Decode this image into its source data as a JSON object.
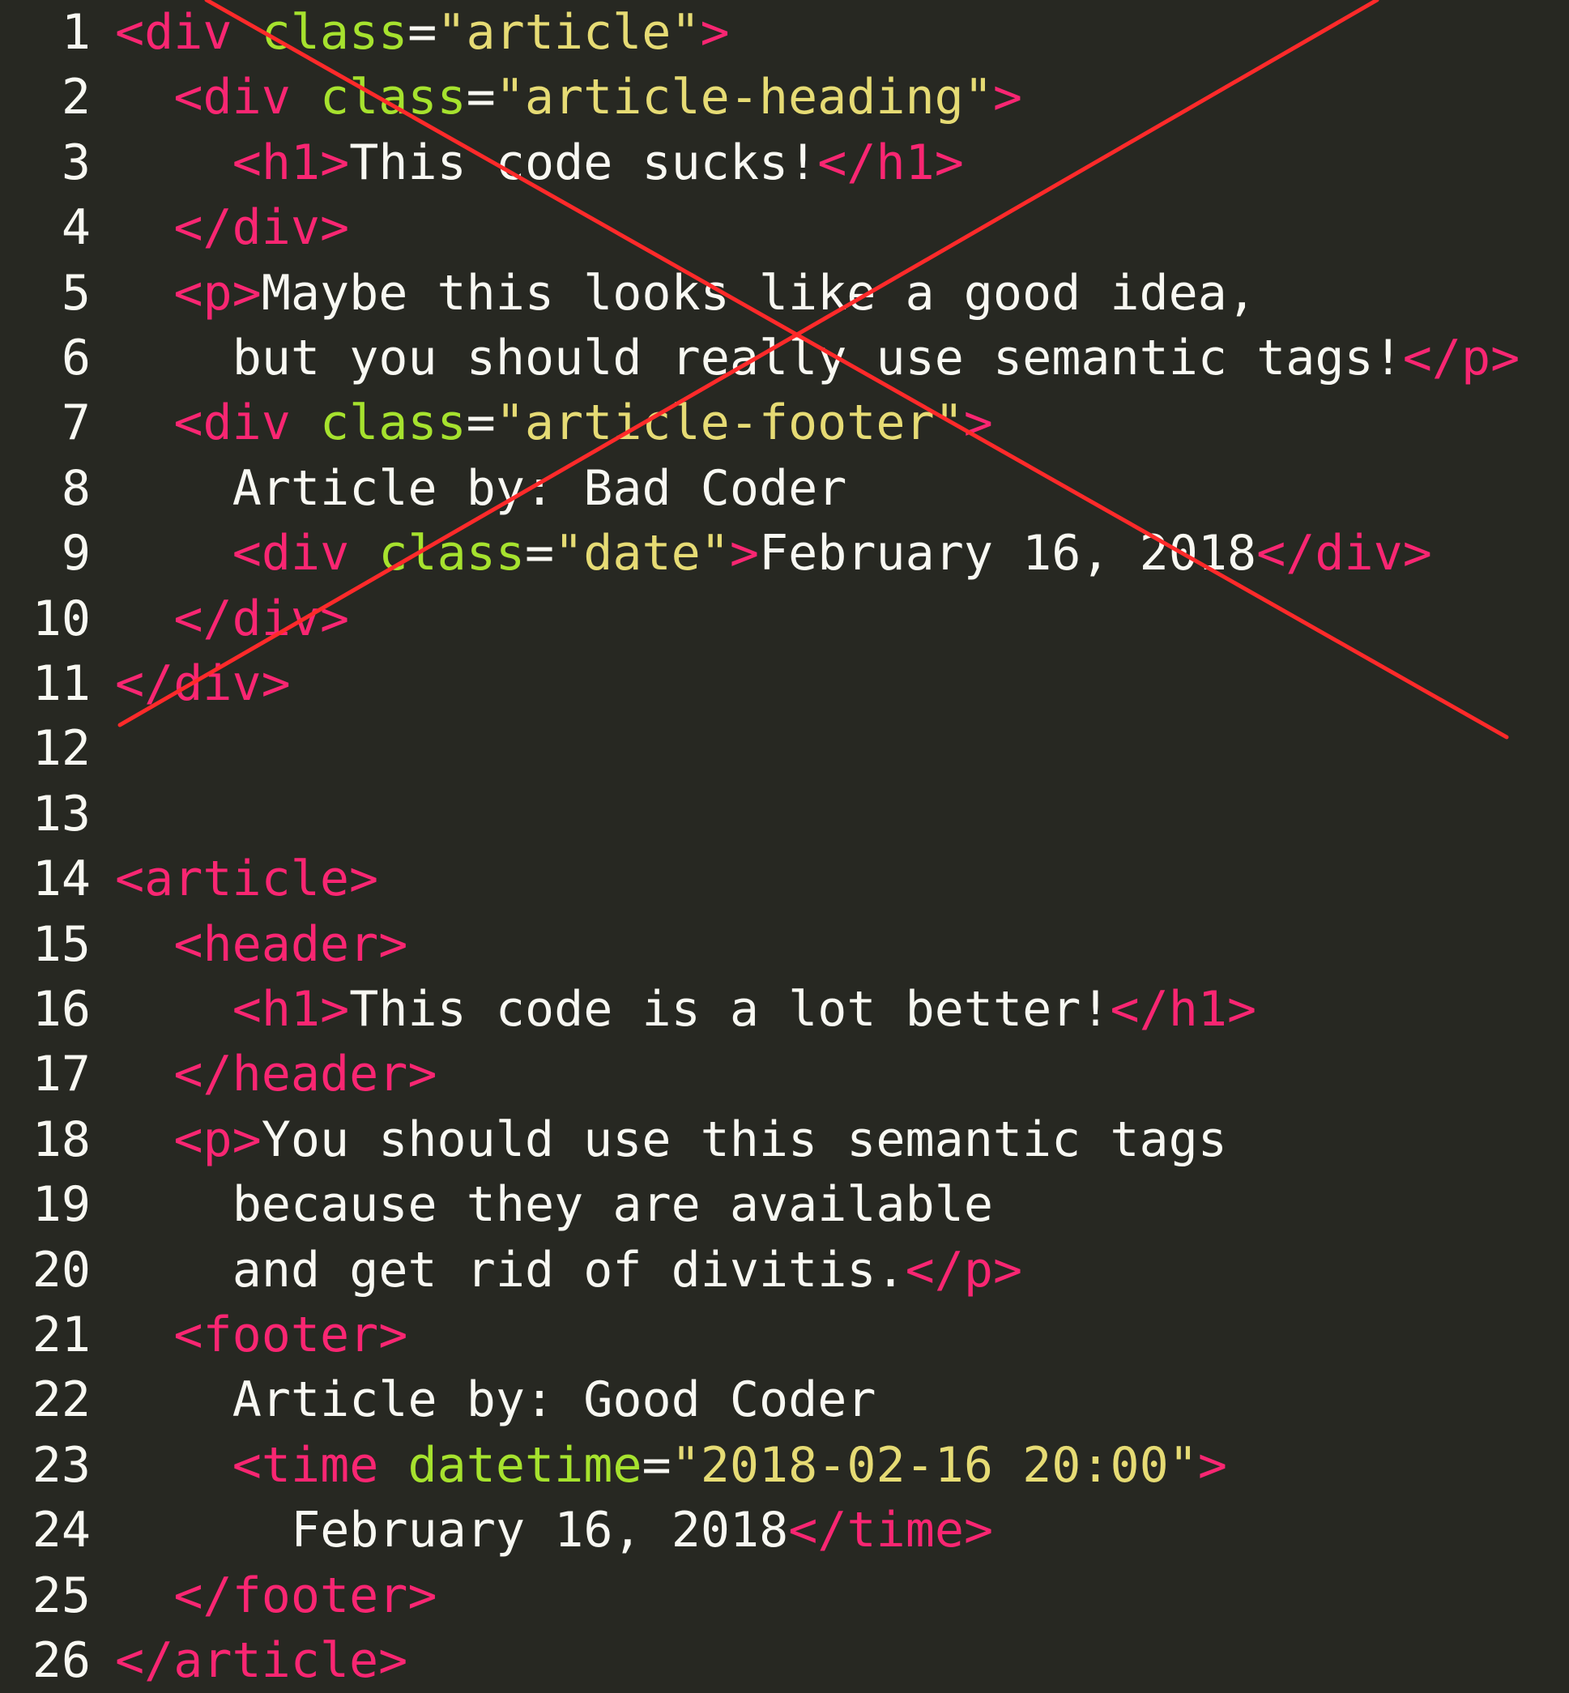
{
  "editor": {
    "theme": {
      "background": "#272822",
      "tag": "#f92672",
      "attribute": "#a6e22e",
      "string": "#e6db74",
      "text": "#f8f8f2",
      "strike": "#ff2a2a"
    },
    "lines": [
      {
        "number": "1",
        "indent": 0,
        "tokens": [
          {
            "t": "tag",
            "v": "<div"
          },
          {
            "t": "text",
            "v": " "
          },
          {
            "t": "attr",
            "v": "class"
          },
          {
            "t": "eq",
            "v": "="
          },
          {
            "t": "str",
            "v": "\"article\""
          },
          {
            "t": "tag",
            "v": ">"
          }
        ]
      },
      {
        "number": "2",
        "indent": 1,
        "tokens": [
          {
            "t": "tag",
            "v": "<div"
          },
          {
            "t": "text",
            "v": " "
          },
          {
            "t": "attr",
            "v": "class"
          },
          {
            "t": "eq",
            "v": "="
          },
          {
            "t": "str",
            "v": "\"article-heading\""
          },
          {
            "t": "tag",
            "v": ">"
          }
        ]
      },
      {
        "number": "3",
        "indent": 2,
        "tokens": [
          {
            "t": "tag",
            "v": "<h1>"
          },
          {
            "t": "text",
            "v": "This code sucks!"
          },
          {
            "t": "tag",
            "v": "</h1>"
          }
        ]
      },
      {
        "number": "4",
        "indent": 1,
        "tokens": [
          {
            "t": "tag",
            "v": "</div>"
          }
        ]
      },
      {
        "number": "5",
        "indent": 1,
        "tokens": [
          {
            "t": "tag",
            "v": "<p>"
          },
          {
            "t": "text",
            "v": "Maybe this looks like a good idea,"
          }
        ]
      },
      {
        "number": "6",
        "indent": 2,
        "tokens": [
          {
            "t": "text",
            "v": "but you should really use semantic tags!"
          },
          {
            "t": "tag",
            "v": "</p>"
          }
        ]
      },
      {
        "number": "7",
        "indent": 1,
        "tokens": [
          {
            "t": "tag",
            "v": "<div"
          },
          {
            "t": "text",
            "v": " "
          },
          {
            "t": "attr",
            "v": "class"
          },
          {
            "t": "eq",
            "v": "="
          },
          {
            "t": "str",
            "v": "\"article-footer\""
          },
          {
            "t": "tag",
            "v": ">"
          }
        ]
      },
      {
        "number": "8",
        "indent": 2,
        "tokens": [
          {
            "t": "text",
            "v": "Article by: Bad Coder"
          }
        ]
      },
      {
        "number": "9",
        "indent": 2,
        "tokens": [
          {
            "t": "tag",
            "v": "<div"
          },
          {
            "t": "text",
            "v": " "
          },
          {
            "t": "attr",
            "v": "class"
          },
          {
            "t": "eq",
            "v": "="
          },
          {
            "t": "str",
            "v": "\"date\""
          },
          {
            "t": "tag",
            "v": ">"
          },
          {
            "t": "text",
            "v": "February 16, 2018"
          },
          {
            "t": "tag",
            "v": "</div>"
          }
        ]
      },
      {
        "number": "10",
        "indent": 1,
        "tokens": [
          {
            "t": "tag",
            "v": "</div>"
          }
        ]
      },
      {
        "number": "11",
        "indent": 0,
        "tokens": [
          {
            "t": "tag",
            "v": "</div>"
          }
        ]
      },
      {
        "number": "12",
        "indent": 0,
        "tokens": []
      },
      {
        "number": "13",
        "indent": 0,
        "tokens": []
      },
      {
        "number": "14",
        "indent": 0,
        "tokens": [
          {
            "t": "tag",
            "v": "<article>"
          }
        ]
      },
      {
        "number": "15",
        "indent": 1,
        "tokens": [
          {
            "t": "tag",
            "v": "<header>"
          }
        ]
      },
      {
        "number": "16",
        "indent": 2,
        "tokens": [
          {
            "t": "tag",
            "v": "<h1>"
          },
          {
            "t": "text",
            "v": "This code is a lot better!"
          },
          {
            "t": "tag",
            "v": "</h1>"
          }
        ]
      },
      {
        "number": "17",
        "indent": 1,
        "tokens": [
          {
            "t": "tag",
            "v": "</header>"
          }
        ]
      },
      {
        "number": "18",
        "indent": 1,
        "tokens": [
          {
            "t": "tag",
            "v": "<p>"
          },
          {
            "t": "text",
            "v": "You should use this semantic tags"
          }
        ]
      },
      {
        "number": "19",
        "indent": 2,
        "tokens": [
          {
            "t": "text",
            "v": "because they are available"
          }
        ]
      },
      {
        "number": "20",
        "indent": 2,
        "tokens": [
          {
            "t": "text",
            "v": "and get rid of divitis."
          },
          {
            "t": "tag",
            "v": "</p>"
          }
        ]
      },
      {
        "number": "21",
        "indent": 1,
        "tokens": [
          {
            "t": "tag",
            "v": "<footer>"
          }
        ]
      },
      {
        "number": "22",
        "indent": 2,
        "tokens": [
          {
            "t": "text",
            "v": "Article by: Good Coder"
          }
        ]
      },
      {
        "number": "23",
        "indent": 2,
        "tokens": [
          {
            "t": "tag",
            "v": "<time"
          },
          {
            "t": "text",
            "v": " "
          },
          {
            "t": "attr",
            "v": "datetime"
          },
          {
            "t": "eq",
            "v": "="
          },
          {
            "t": "str",
            "v": "\"2018-02-16 20:00\""
          },
          {
            "t": "tag",
            "v": ">"
          }
        ]
      },
      {
        "number": "24",
        "indent": 3,
        "tokens": [
          {
            "t": "text",
            "v": "February 16, 2018"
          },
          {
            "t": "tag",
            "v": "</time>"
          }
        ]
      },
      {
        "number": "25",
        "indent": 1,
        "tokens": [
          {
            "t": "tag",
            "v": "</footer>"
          }
        ]
      },
      {
        "number": "26",
        "indent": 0,
        "tokens": [
          {
            "t": "tag",
            "v": "</article>"
          }
        ]
      }
    ],
    "strikeout_line_range": [
      "1",
      "11"
    ]
  }
}
